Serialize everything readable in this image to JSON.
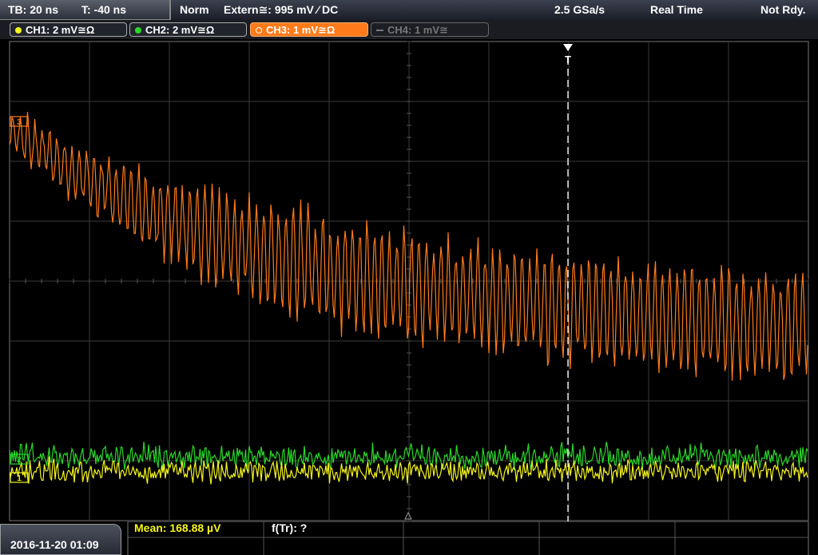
{
  "status": {
    "timebase": "TB: 20 ns",
    "trigger_time": "T: -40 ns",
    "trigger_mode": "Norm",
    "trigger_source": "Extern≅: 995 mV ⁄ DC",
    "sample_rate": "2.5 GSa/s",
    "acq_mode": "Real Time",
    "ready_state": "Not Rdy."
  },
  "channels": [
    {
      "label": "CH1: 2 mV≅Ω",
      "color": "#f5f51e"
    },
    {
      "label": "CH2: 2 mV≅Ω",
      "color": "#28d828"
    },
    {
      "label": "CH3: 1 mV≅Ω",
      "color": "#ff7a1a"
    },
    {
      "label": "CH4: 1 mV≅",
      "color": "#777777"
    }
  ],
  "trace_labels": {
    "ch3": "3",
    "ch2": "2",
    "ch1": "1"
  },
  "trigger_marker": "T",
  "bottom": {
    "datetime": "2016-11-20 01:09",
    "mean": "Mean: 168.88 µV",
    "freq": "f(Tr): ?"
  },
  "colors": {
    "grid": "#3a3a3a",
    "ch1": "#f5f51e",
    "ch2": "#28d828",
    "ch3": "#ff7a1a",
    "trigger": "#ffffff"
  }
}
